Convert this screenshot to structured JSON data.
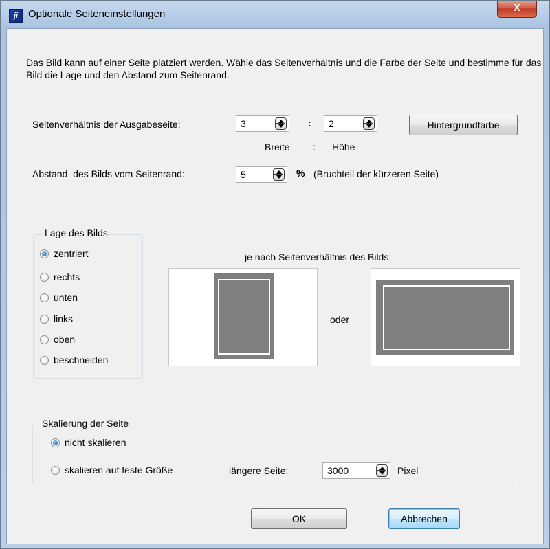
{
  "window": {
    "title": "Optionale Seiteneinstellungen",
    "icon": "ji",
    "close_label": "X"
  },
  "intro_text": "Das Bild kann auf einer Seite platziert werden. Wähle das Seitenverhältnis und die Farbe der Seite und bestimme für das Bild die Lage und den Abstand zum Seitenrand.",
  "aspect": {
    "label": "Seitenverhältnis der Ausgabeseite:",
    "width_value": "3",
    "separator": ":",
    "height_value": "2",
    "width_caption": "Breite",
    "caption_separator": ":",
    "height_caption": "Höhe",
    "bg_button": "Hintergrundfarbe"
  },
  "margin": {
    "label": "Abstand  des Bilds vom Seitenrand:",
    "value": "5",
    "unit": "%",
    "note": "(Bruchteil der kürzeren Seite)"
  },
  "position": {
    "legend": "Lage des Bilds",
    "options": [
      "zentriert",
      "rechts",
      "unten",
      "links",
      "oben",
      "beschneiden"
    ],
    "selected": "zentriert"
  },
  "preview": {
    "caption": "je nach Seitenverhältnis des Bilds:",
    "or_label": "oder",
    "photo_color": "#7f7f7f"
  },
  "scaling": {
    "legend": "Skalierung der Seite",
    "option_none": "nicht skalieren",
    "option_fixed": "skalieren auf feste Größe",
    "selected": "nicht skalieren",
    "longer_side_label": "längere Seite:",
    "longer_side_value": "3000",
    "unit": "Pixel"
  },
  "buttons": {
    "ok": "OK",
    "cancel": "Abbrechen"
  }
}
